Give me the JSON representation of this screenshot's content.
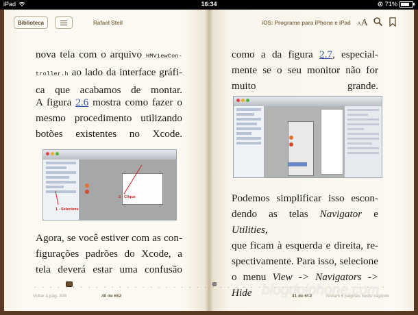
{
  "status_bar": {
    "device": "iPad",
    "time": "16:34",
    "battery": "71%"
  },
  "toolbar": {
    "library_label": "Biblioteca",
    "author": "Rafael Steil",
    "book_title": "iOS: Programe para iPhone e iPad",
    "font_small": "A",
    "font_big": "A"
  },
  "left_page": {
    "para1": {
      "line1_pre": "nova tela com o arquivo ",
      "line1_code": "HMViewCon-",
      "line2_code": "troller.h",
      "line2_post": " ao lado da interface gráfi-",
      "line3": "ca que acabamos de montar."
    },
    "para2": {
      "line1_pre": "A figura ",
      "line1_link": "2.6",
      "line1_post": " mostra como fazer o",
      "line2": "mesmo procedimento utilizando",
      "line3": "botões existentes no Xcode."
    },
    "figure": {
      "label_select": "1 - Selecione",
      "label_click": "2 - Clique"
    },
    "para3": {
      "line1": "Agora, se você estiver com as con-",
      "line2": "figurações padrões do Xcode, a",
      "line3": "tela deverá estar uma confusão"
    },
    "footer": {
      "back": "Voltar à pág. 308",
      "page": "40 de 652"
    }
  },
  "right_page": {
    "para1": {
      "line1_pre": "como a da figura ",
      "line1_link": "2.7",
      "line1_post": ", especial-",
      "line2": "mente se o seu monitor não for",
      "line3": "muito grande."
    },
    "para2": {
      "line1": "Podemos simplificar isso escon-",
      "line2_pre": "dendo as telas ",
      "line2_em1": "Navigator",
      "line2_mid": " e ",
      "line2_em2": "Utilities",
      "line2_post": ",",
      "line3": "que ficam à esquerda e direita, re-",
      "line4": "spectivamente. Para isso, selecione",
      "line5_pre": "o menu ",
      "line5_em": "View -> Navigators -> Hide"
    },
    "footer": {
      "page": "41 de 652",
      "remaining": "restam 6 páginas neste capítulo"
    }
  },
  "scrubber": {
    "dots": "· · · · · · · · · · · · · · · · · · · · · · · · · · · · · · · · · · · · · · · · · · · · · · · · · · · · · · · · · · · · · · · · · · · · · · · · · · · · · · · · · · · · · · · · · · · · · · · ·",
    "position": 0.1
  },
  "watermark": "blogdoiphone.com"
}
